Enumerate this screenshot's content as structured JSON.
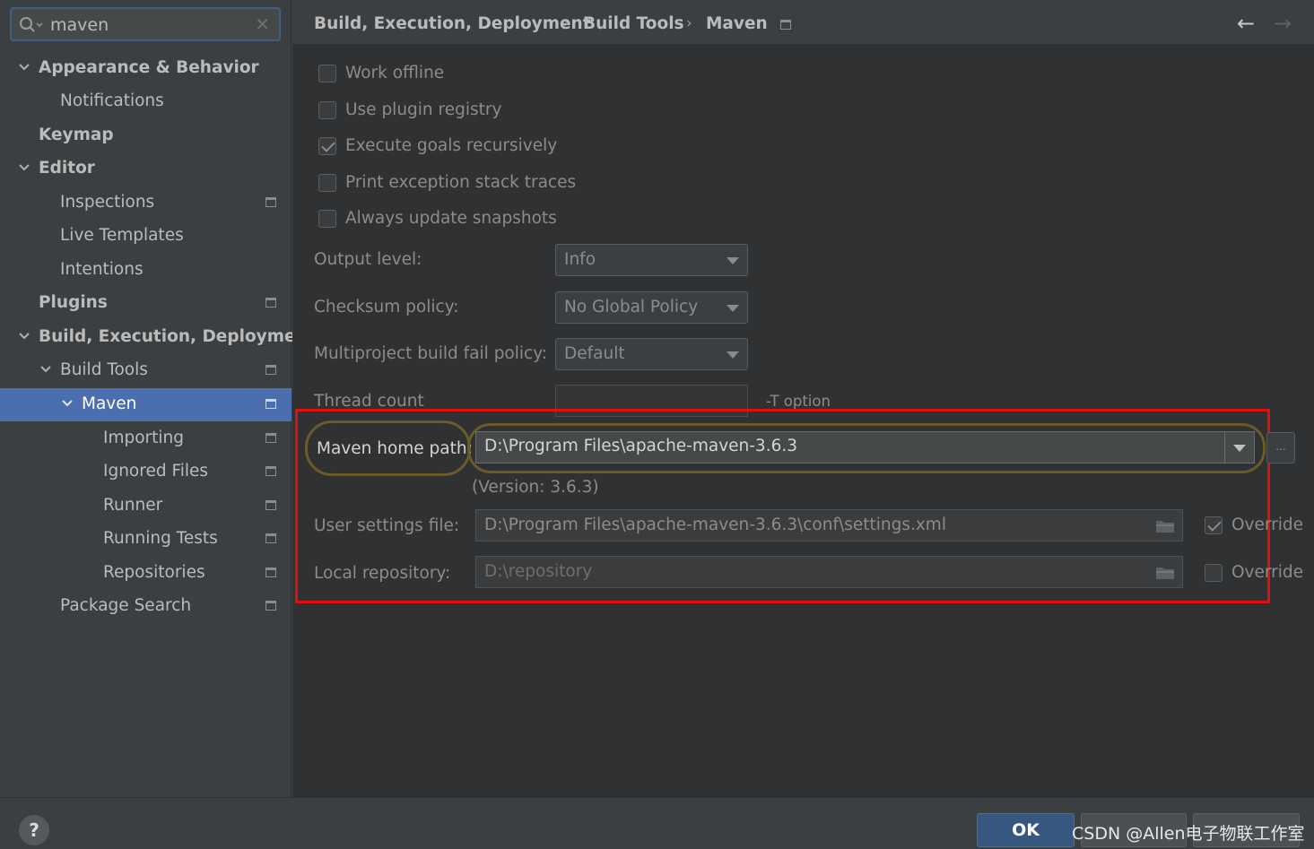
{
  "search": {
    "value": "maven"
  },
  "sidebar": {
    "items": [
      {
        "label": "Appearance & Behavior"
      },
      {
        "label": "Notifications"
      },
      {
        "label": "Keymap"
      },
      {
        "label": "Editor"
      },
      {
        "label": "Inspections"
      },
      {
        "label": "Live Templates"
      },
      {
        "label": "Intentions"
      },
      {
        "label": "Plugins"
      },
      {
        "label": "Build, Execution, Deployment"
      },
      {
        "label": "Build Tools"
      },
      {
        "label": "Maven"
      },
      {
        "label": "Importing"
      },
      {
        "label": "Ignored Files"
      },
      {
        "label": "Runner"
      },
      {
        "label": "Running Tests"
      },
      {
        "label": "Repositories"
      },
      {
        "label": "Package Search"
      }
    ]
  },
  "breadcrumb": {
    "items": [
      "Build, Execution, Deployment",
      "Build Tools",
      "Maven"
    ],
    "separator": "›"
  },
  "options": {
    "work_offline": {
      "label": "Work offline",
      "checked": false
    },
    "use_plugin_registry": {
      "label": "Use plugin registry",
      "checked": false
    },
    "execute_goals_recursively": {
      "label": "Execute goals recursively",
      "checked": true
    },
    "print_exception_stack_traces": {
      "label": "Print exception stack traces",
      "checked": false
    },
    "always_update_snapshots": {
      "label": "Always update snapshots",
      "checked": false
    }
  },
  "fields": {
    "output_level": {
      "label": "Output level:",
      "value": "Info"
    },
    "checksum_policy": {
      "label": "Checksum policy:",
      "value": "No Global Policy"
    },
    "multiproject_fail_policy": {
      "label": "Multiproject build fail policy:",
      "value": "Default"
    },
    "thread_count": {
      "label": "Thread count",
      "value": "",
      "hint": "-T option"
    },
    "maven_home": {
      "label": "Maven home path:",
      "value": "D:\\Program Files\\apache-maven-3.6.3",
      "browse": "...",
      "version": "(Version: 3.6.3)"
    },
    "user_settings": {
      "label": "User settings file:",
      "value": "D:\\Program Files\\apache-maven-3.6.3\\conf\\settings.xml",
      "override_label": "Override",
      "override_checked": true
    },
    "local_repository": {
      "label": "Local repository:",
      "value": "D:\\repository",
      "override_label": "Override",
      "override_checked": false
    }
  },
  "footer": {
    "help": "?",
    "ok_label": "OK",
    "watermark": "CSDN @Allen电子物联工作室"
  },
  "colors": {
    "accent": "#4b6eaf",
    "highlight_box": "#e01010",
    "annotation_outline": "#6b5a2a"
  }
}
